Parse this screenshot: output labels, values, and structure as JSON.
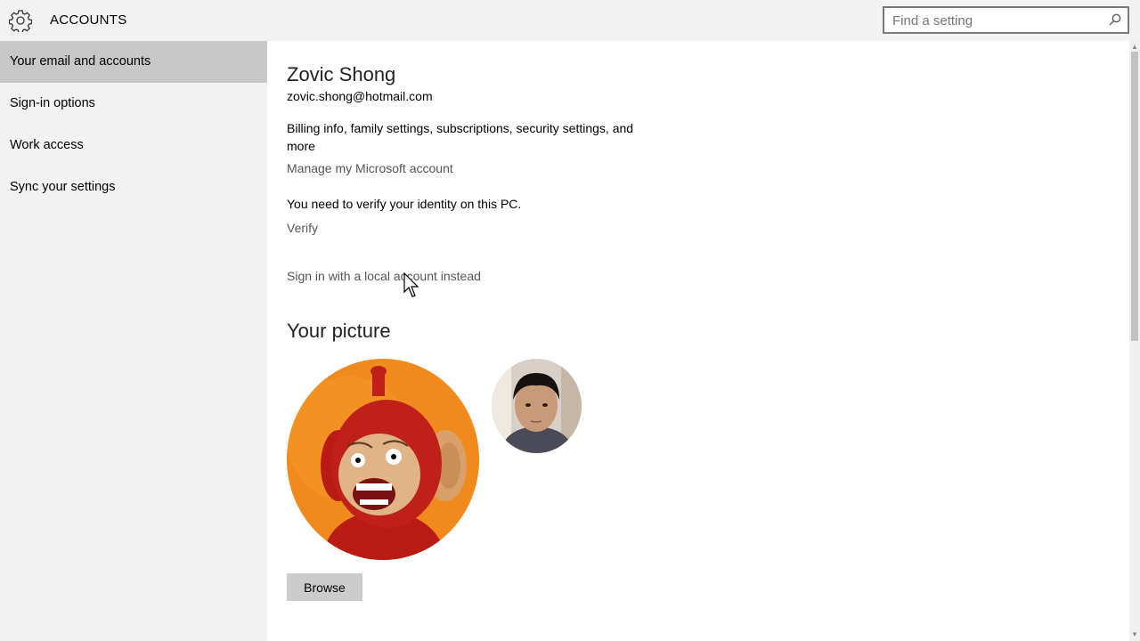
{
  "header": {
    "title": "ACCOUNTS",
    "search_placeholder": "Find a setting"
  },
  "sidebar": {
    "items": [
      {
        "label": "Your email and accounts",
        "selected": true
      },
      {
        "label": "Sign-in options",
        "selected": false
      },
      {
        "label": "Work access",
        "selected": false
      },
      {
        "label": "Sync your settings",
        "selected": false
      }
    ]
  },
  "main": {
    "user_name": "Zovic Shong",
    "user_email": "zovic.shong@hotmail.com",
    "billing_text": "Billing info, family settings, subscriptions, security settings, and more",
    "manage_link": "Manage my Microsoft account",
    "verify_message": "You need to verify your identity on this PC.",
    "verify_link": "Verify",
    "local_account_link": "Sign in with a local account instead",
    "picture_title": "Your picture",
    "browse_label": "Browse"
  },
  "colors": {
    "sidebar_bg": "#f2f2f2",
    "selected_bg": "#c8c8c8",
    "content_bg": "#ffffff",
    "link": "#555555",
    "avatar_orange": "#f08a1c",
    "avatar_red": "#c0201a"
  }
}
